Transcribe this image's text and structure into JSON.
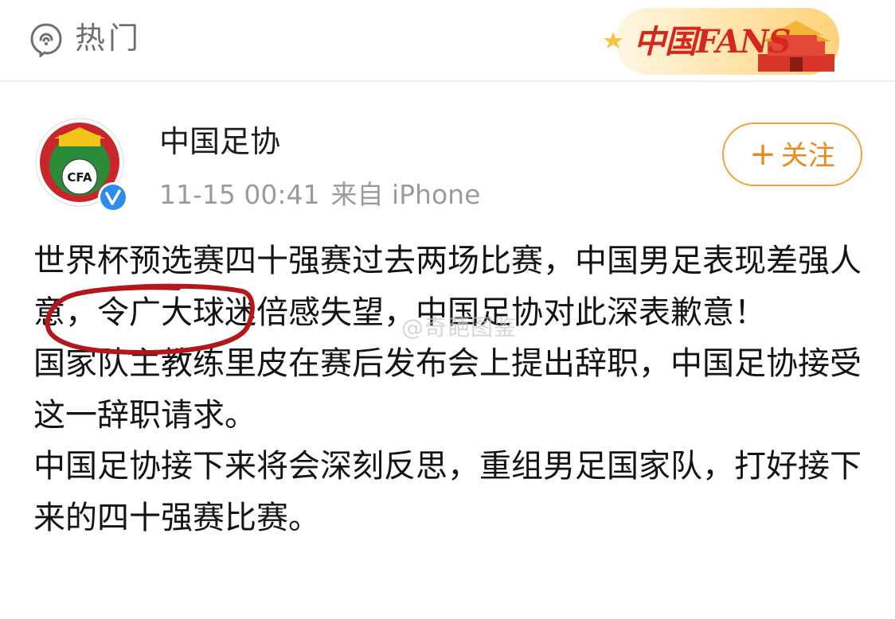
{
  "topbar": {
    "section_label": "热门",
    "section_icon": "hot-topic-icon",
    "badge_text": "中国FANS"
  },
  "post": {
    "author": "中国足协",
    "avatar_text": "CFA",
    "timestamp": "11-15 00:41",
    "source": "来自 iPhone",
    "follow_label": "关注",
    "paragraphs": [
      "世界杯预选赛四十强赛过去两场比赛，中国男足表现差强人意，令广大球迷倍感失望，中国足协对此深表歉意！",
      "国家队主教练里皮在赛后发布会上提出辞职，中国足协接受这一辞职请求。",
      "中国足协接下来将会深刻反思，重组男足国家队，打好接下来的四十强赛比赛。"
    ],
    "watermark": "@奇葩图鉴"
  },
  "colors": {
    "accent_orange": "#e98a1a",
    "verified_blue": "#2d8cf0",
    "annotation_red": "#b3171b",
    "logo_green": "#2a8c3a"
  }
}
